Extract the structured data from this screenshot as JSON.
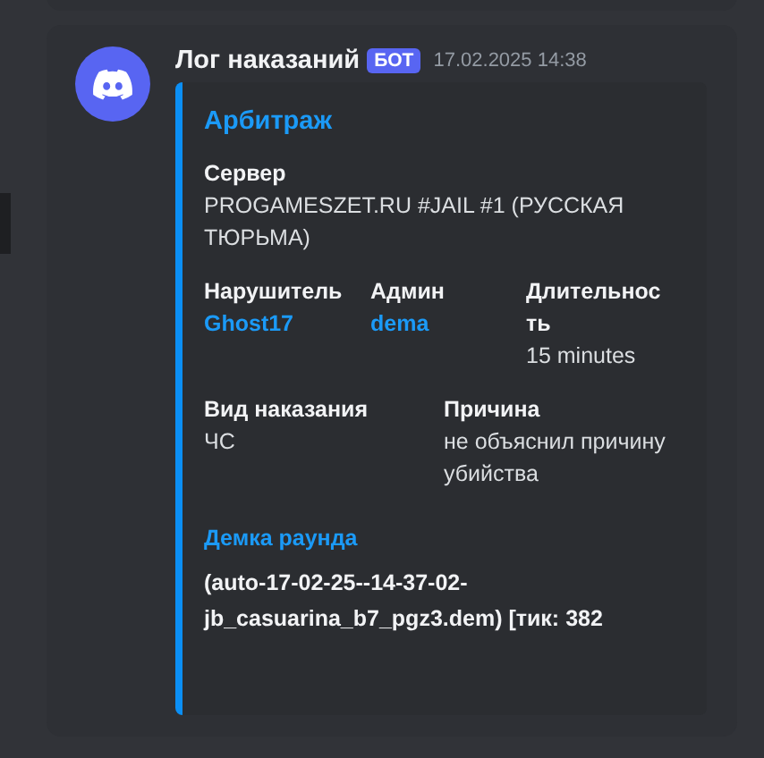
{
  "message": {
    "author": "Лог наказаний",
    "badge": "БОТ",
    "timestamp": "17.02.2025 14:38",
    "embed": {
      "title": "Арбитраж",
      "fields": [
        {
          "name": "Сервер",
          "value": "PROGAMESZET.RU #JAIL #1 (РУССКАЯ ТЮРЬМА)",
          "inline": false,
          "kind": "text"
        },
        {
          "name": "Нарушитель",
          "value": "Ghost17",
          "inline": true,
          "kind": "mention"
        },
        {
          "name": "Админ",
          "value": "dema",
          "inline": true,
          "kind": "mention"
        },
        {
          "name": "Длительность",
          "value": "15 minutes",
          "inline": true,
          "kind": "text"
        },
        {
          "name": "Вид наказания",
          "value": "ЧС",
          "inline": true,
          "kind": "text"
        },
        {
          "name": "Причина",
          "value": "не объяснил причину убийства",
          "inline": true,
          "kind": "text"
        },
        {
          "name": "Демка раунда",
          "value": "(auto-17-02-25--14-37-02-jb_casuarina_b7_pgz3.dem) [тик: 382",
          "inline": false,
          "kind": "demo"
        }
      ]
    }
  }
}
